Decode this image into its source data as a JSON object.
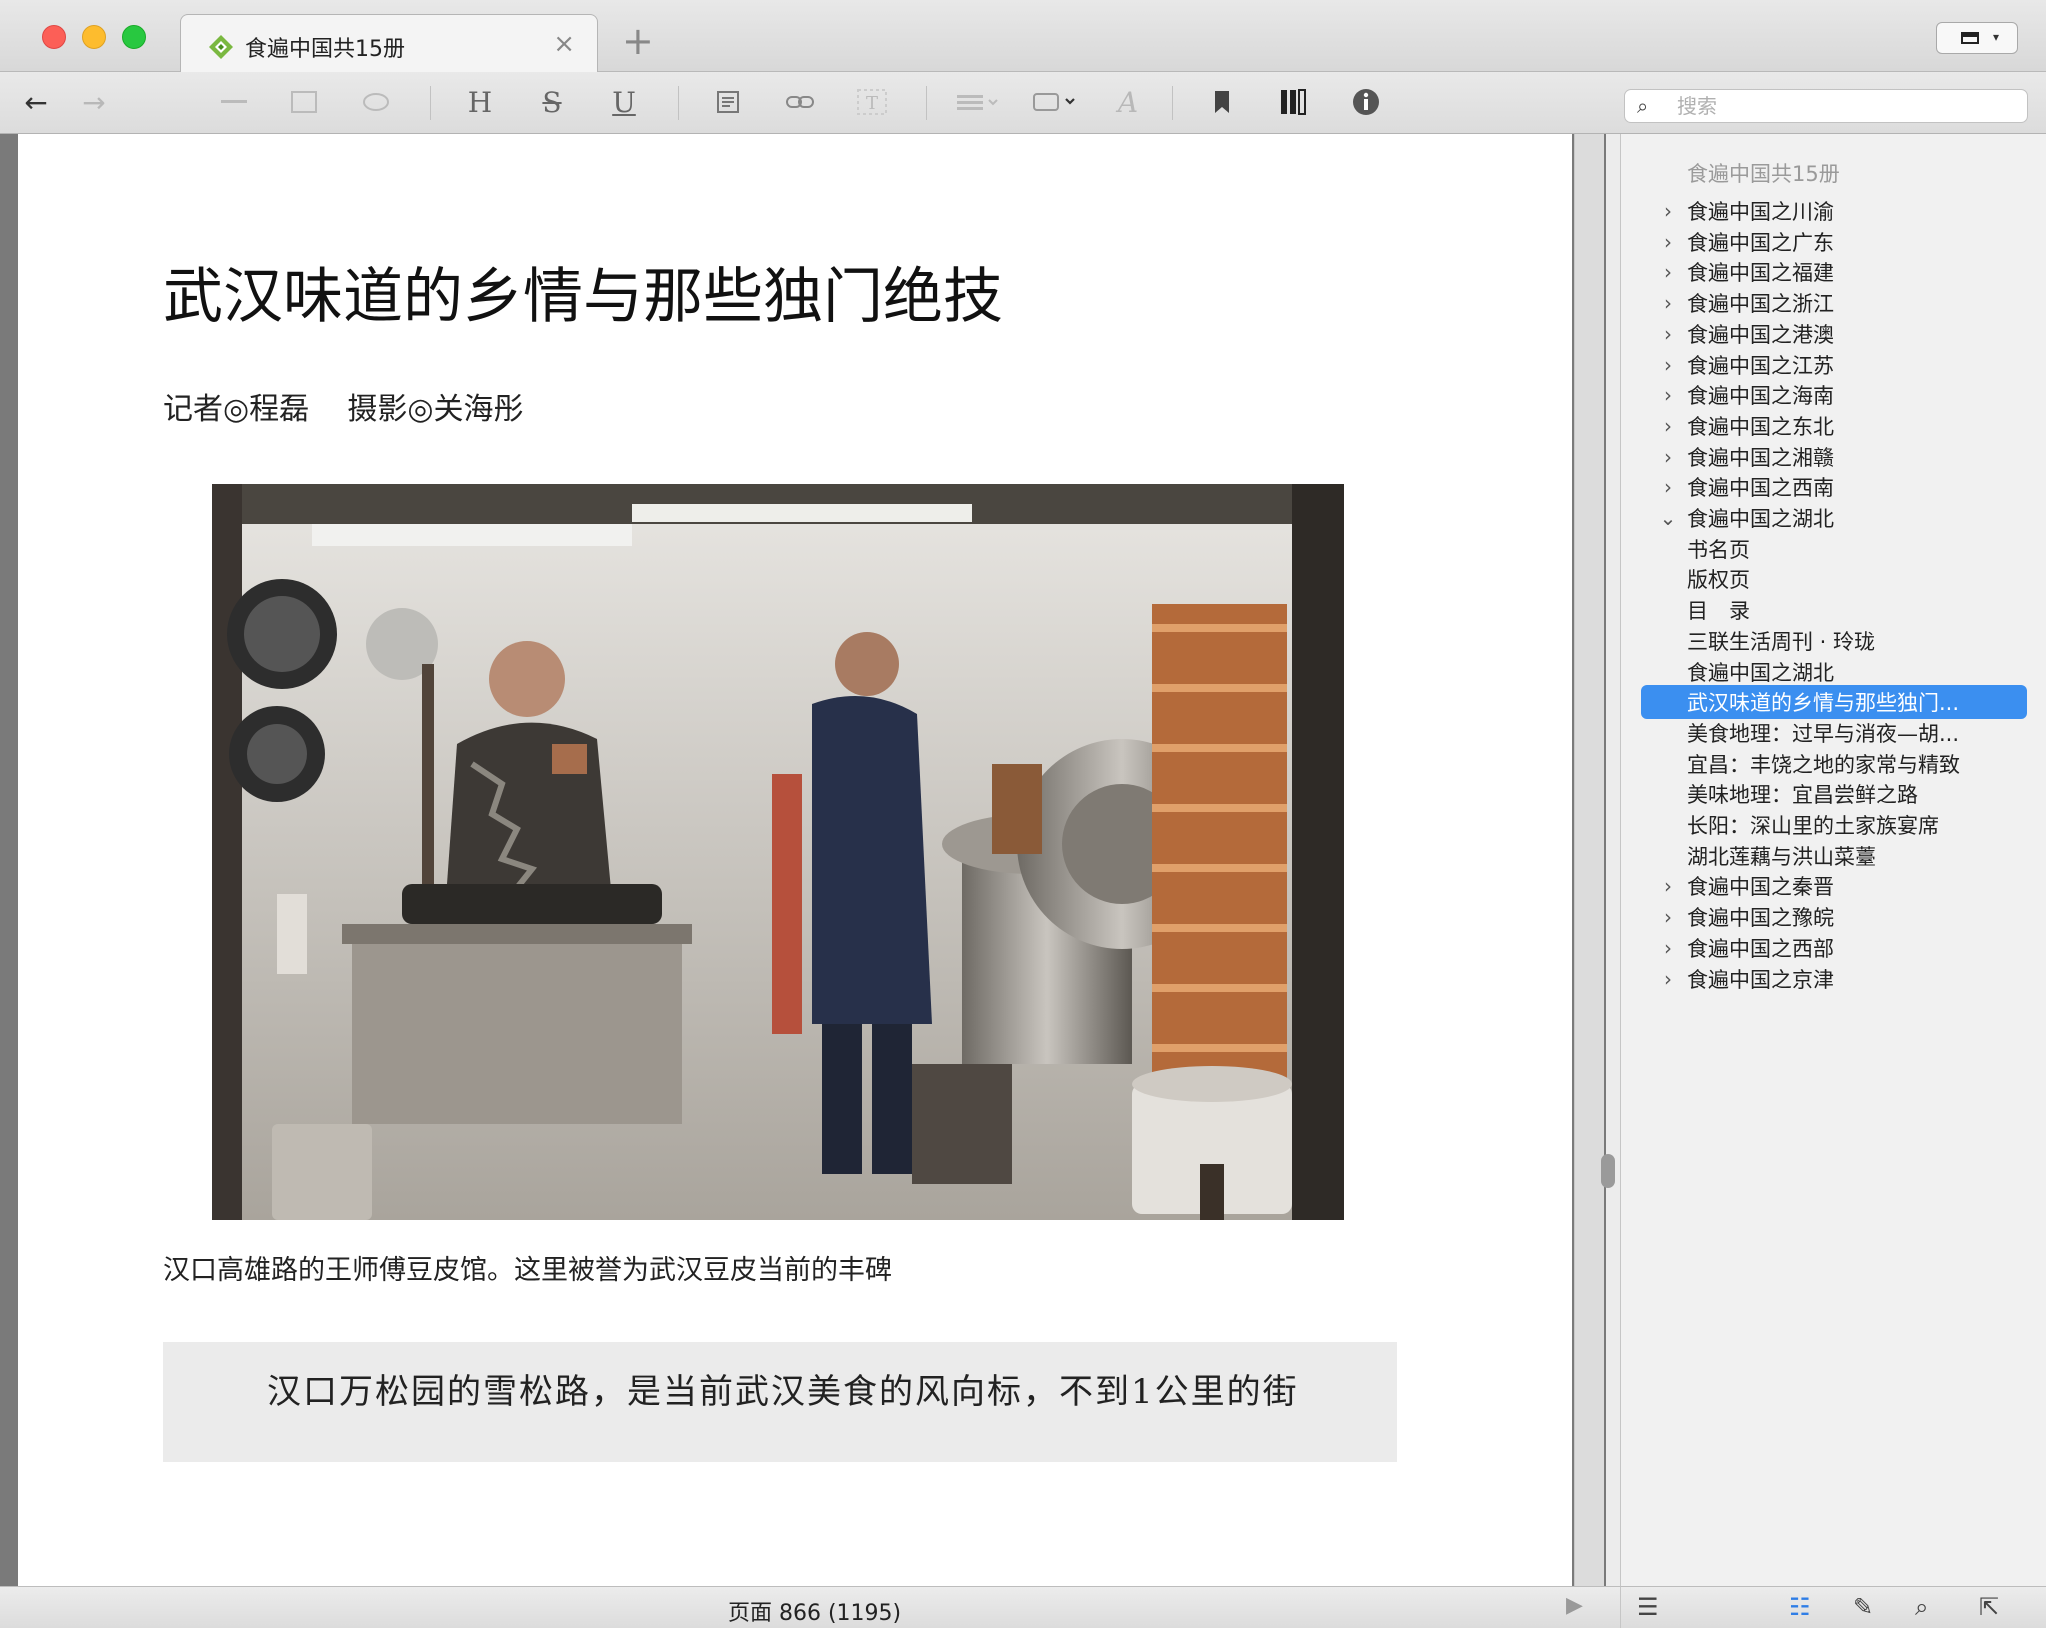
{
  "tab": {
    "title": "食遍中国共15册",
    "close_glyph": "×",
    "add_glyph": "+"
  },
  "toolbar": {
    "back": "←",
    "forward": "→",
    "h_label": "H",
    "s_label": "S",
    "u_label": "U",
    "font_label": "A",
    "search_placeholder": "搜索"
  },
  "article": {
    "title": "武汉味道的乡情与那些独门绝技",
    "byline": "记者◎程磊    摄影◎关海彤",
    "caption": "汉口高雄路的王师傅豆皮馆。这里被誉为武汉豆皮当前的丰碑",
    "quote": "汉口万松园的雪松路，是当前武汉美食的风向标，不到1公里的街"
  },
  "status": {
    "page_label": "页面 866 (1195)"
  },
  "toc": {
    "heading": "食遍中国共15册",
    "items": [
      {
        "label": "食遍中国之川渝",
        "level": 0,
        "expanded": false
      },
      {
        "label": "食遍中国之广东",
        "level": 0,
        "expanded": false
      },
      {
        "label": "食遍中国之福建",
        "level": 0,
        "expanded": false
      },
      {
        "label": "食遍中国之浙江",
        "level": 0,
        "expanded": false
      },
      {
        "label": "食遍中国之港澳",
        "level": 0,
        "expanded": false
      },
      {
        "label": "食遍中国之江苏",
        "level": 0,
        "expanded": false
      },
      {
        "label": "食遍中国之海南",
        "level": 0,
        "expanded": false
      },
      {
        "label": "食遍中国之东北",
        "level": 0,
        "expanded": false
      },
      {
        "label": "食遍中国之湘赣",
        "level": 0,
        "expanded": false
      },
      {
        "label": "食遍中国之西南",
        "level": 0,
        "expanded": false
      },
      {
        "label": "食遍中国之湖北",
        "level": 0,
        "expanded": true
      },
      {
        "label": "书名页",
        "level": 1
      },
      {
        "label": "版权页",
        "level": 1
      },
      {
        "label": "目　录",
        "level": 1
      },
      {
        "label": "三联生活周刊 · 玲珑",
        "level": 1
      },
      {
        "label": "食遍中国之湖北",
        "level": 1
      },
      {
        "label": "武汉味道的乡情与那些独门...",
        "level": 1,
        "selected": true
      },
      {
        "label": "美食地理：过早与消夜—胡...",
        "level": 1
      },
      {
        "label": "宜昌：丰饶之地的家常与精致",
        "level": 1
      },
      {
        "label": "美味地理：宜昌尝鲜之路",
        "level": 1
      },
      {
        "label": "长阳：深山里的土家族宴席",
        "level": 1
      },
      {
        "label": "湖北莲藕与洪山菜薹",
        "level": 1
      },
      {
        "label": "食遍中国之秦晋",
        "level": 0,
        "expanded": false
      },
      {
        "label": "食遍中国之豫皖",
        "level": 0,
        "expanded": false
      },
      {
        "label": "食遍中国之西部",
        "level": 0,
        "expanded": false
      },
      {
        "label": "食遍中国之京津",
        "level": 0,
        "expanded": false
      }
    ]
  },
  "colors": {
    "selection": "#3b8ff0",
    "accent_blue": "#2f7ee6"
  },
  "icons": [
    "pencil-outline-logo",
    "bookmark-icon",
    "library-icon",
    "info-icon",
    "list-icon",
    "edit-note-icon",
    "search-icon",
    "export-icon"
  ]
}
